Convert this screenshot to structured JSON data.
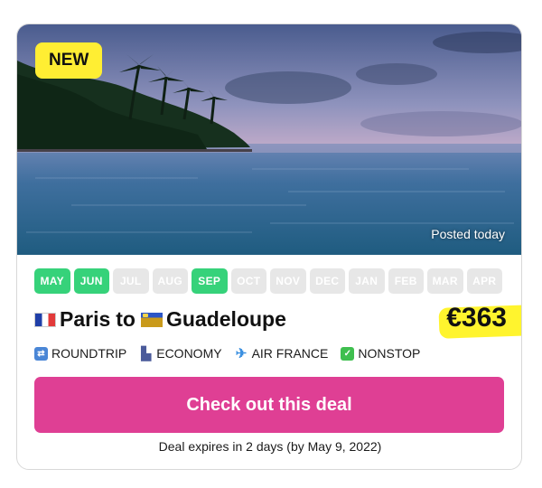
{
  "badge": {
    "label": "NEW"
  },
  "photo": {
    "posted_label": "Posted today"
  },
  "months": [
    {
      "label": "MAY",
      "active": true
    },
    {
      "label": "JUN",
      "active": true
    },
    {
      "label": "JUL",
      "active": false
    },
    {
      "label": "AUG",
      "active": false
    },
    {
      "label": "SEP",
      "active": true
    },
    {
      "label": "OCT",
      "active": false
    },
    {
      "label": "NOV",
      "active": false
    },
    {
      "label": "DEC",
      "active": false
    },
    {
      "label": "JAN",
      "active": false
    },
    {
      "label": "FEB",
      "active": false
    },
    {
      "label": "MAR",
      "active": false
    },
    {
      "label": "APR",
      "active": false
    }
  ],
  "route": {
    "origin": "Paris",
    "connector": "to",
    "destination": "Guadeloupe"
  },
  "price": {
    "label": "€363"
  },
  "features": [
    {
      "label": "ROUNDTRIP",
      "icon": "roundtrip-icon"
    },
    {
      "label": "ECONOMY",
      "icon": "seat-icon"
    },
    {
      "label": "AIR FRANCE",
      "icon": "airplane-icon"
    },
    {
      "label": "NONSTOP",
      "icon": "checkmark-icon"
    }
  ],
  "cta": {
    "label": "Check out this deal"
  },
  "expiry": {
    "text": "Deal expires in 2 days (by May 9, 2022)"
  },
  "colors": {
    "accent": "#df3f94",
    "active_month": "#36d27a",
    "inactive_month": "#e7e7e7",
    "highlight": "#ffee33"
  }
}
